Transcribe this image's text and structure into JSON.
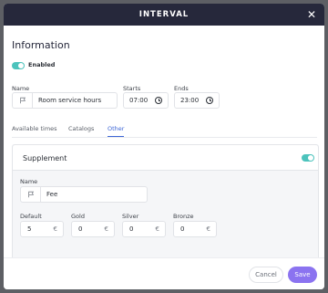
{
  "dialog": {
    "title": "INTERVAL",
    "close_icon": "close-icon"
  },
  "information": {
    "heading": "Information",
    "enabled_label": "Enabled",
    "enabled": true,
    "name_label": "Name",
    "name_value": "Room service hours",
    "starts_label": "Starts",
    "starts_value": "07:00",
    "ends_label": "Ends",
    "ends_value": "23:00"
  },
  "tabs": [
    {
      "label": "Available times",
      "active": false
    },
    {
      "label": "Catalogs",
      "active": false
    },
    {
      "label": "Other",
      "active": true
    }
  ],
  "supplement": {
    "heading": "Supplement",
    "enabled": true,
    "name_label": "Name",
    "name_value": "Fee",
    "amounts": [
      {
        "label": "Default",
        "value": "5",
        "currency": "€"
      },
      {
        "label": "Gold",
        "value": "0",
        "currency": "€"
      },
      {
        "label": "Silver",
        "value": "0",
        "currency": "€"
      },
      {
        "label": "Bronze",
        "value": "0",
        "currency": "€"
      }
    ]
  },
  "footer": {
    "cancel_label": "Cancel",
    "save_label": "Save"
  },
  "colors": {
    "title_bar": "#26283b",
    "toggle": "#4cc3bc",
    "active_tab": "#3d66d6",
    "save_button": "#8b73f0"
  },
  "icons": {
    "flag": "flag-icon",
    "clock": "clock-icon",
    "close": "close-icon"
  }
}
